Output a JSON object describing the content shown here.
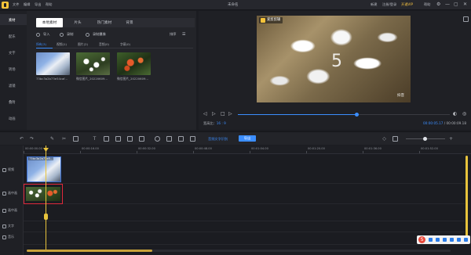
{
  "titlebar": {
    "menus": [
      "文件",
      "编辑",
      "导出",
      "帮助"
    ],
    "title": "未命名",
    "right": [
      "新建",
      "注册/登录",
      "开通VIP",
      "帮助"
    ],
    "controls": [
      "⚙",
      "—",
      "▢",
      "✕"
    ]
  },
  "sidebar": {
    "items": [
      "素材",
      "配乐",
      "文字",
      "转场",
      "滤镜",
      "叠附",
      "动画"
    ]
  },
  "library": {
    "tabs": [
      "本地素材",
      "片头",
      "热门素材",
      "背景"
    ],
    "import_label": "导入",
    "record_label": "录制",
    "record_camera_label": "录制摄像",
    "sort_label": "排序",
    "filters": [
      "所有(3)",
      "视频(1)",
      "图片(2)",
      "音频(0)",
      "字幕(0)"
    ],
    "items": [
      {
        "label": "73bc3a2b73e54caf..."
      },
      {
        "label": "微信图片_20220609..."
      },
      {
        "label": "微信图片_20220609..."
      }
    ]
  },
  "preview": {
    "badge": "爱剪剪辑",
    "big_number": "5",
    "watermark": "抖音",
    "ratio_label": "宽高比：",
    "ratio_value": "16 : 9",
    "current_time": "00:00:05.17",
    "total_time": "/ 00:00:09.18",
    "progress": 0.56
  },
  "toolbar": {
    "audio_link": "音频文字识别",
    "export": "导出"
  },
  "ruler": {
    "ticks": [
      "00:00:00.00",
      "00:00:16.00",
      "00:00:32.00",
      "00:00:48.00",
      "00:01:04.00",
      "00:01:20.00",
      "00:01:36.00",
      "00:01:52.00"
    ]
  },
  "tracks": {
    "labels": [
      "视频",
      "画中画",
      "画中画",
      "文字",
      "音乐"
    ],
    "main_clip_label": "73bc3a2b73e5..."
  },
  "ime": {
    "logo": "S"
  },
  "colors": {
    "accent": "#3c8eff",
    "playhead": "#e8c33c",
    "highlight": "#e0293b"
  }
}
